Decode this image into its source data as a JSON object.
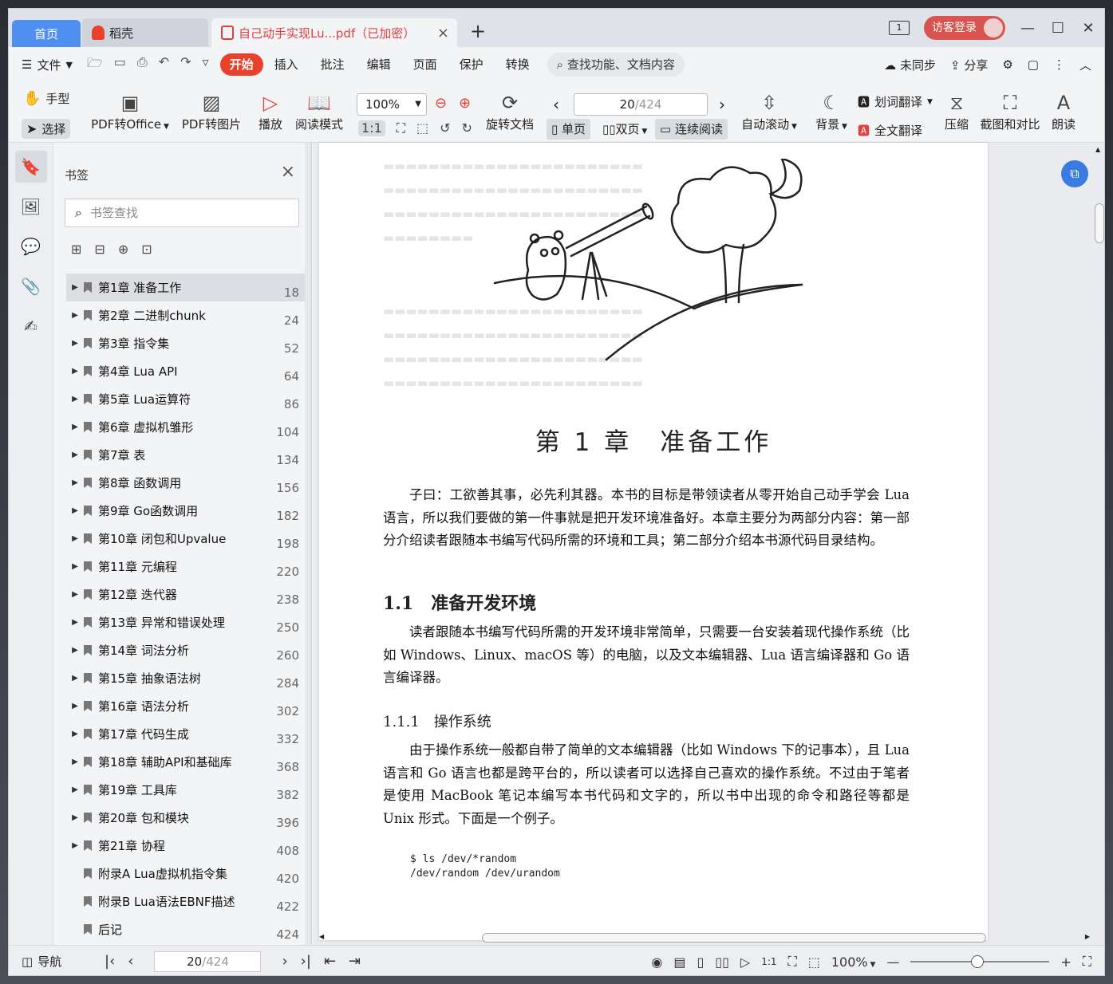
{
  "tabs": {
    "home": "首页",
    "daoke": "稻壳",
    "doc": "自己动手实现Lu...pdf（已加密）",
    "close": "×",
    "new": "+"
  },
  "window": {
    "page_indicator": "1",
    "login": "访客登录",
    "minimize": "—",
    "maximize": "☐",
    "close": "✕"
  },
  "menu": {
    "file": "文件",
    "items": [
      "开始",
      "插入",
      "批注",
      "编辑",
      "页面",
      "保护",
      "转换"
    ],
    "search": "查找功能、文档内容",
    "sync": "未同步",
    "share": "分享"
  },
  "toolbar": {
    "hand": "手型",
    "select": "选择",
    "pdf_office": "PDF转Office",
    "pdf_image": "PDF转图片",
    "play": "播放",
    "read_mode": "阅读模式",
    "zoom": "100%",
    "rotate": "旋转文档",
    "page_current": "20",
    "page_total": "/424",
    "single": "单页",
    "double": "双页",
    "continuous": "连续阅读",
    "auto_scroll": "自动滚动",
    "background": "背景",
    "word_translate": "划词翻译",
    "full_translate": "全文翻译",
    "compress": "压缩",
    "screenshot": "截图和对比",
    "read_aloud": "朗读"
  },
  "panel": {
    "title": "书签",
    "search_placeholder": "书签查找",
    "bookmarks": [
      {
        "label": "第1章 准备工作",
        "page": "18",
        "expand": true
      },
      {
        "label": "第2章 二进制chunk",
        "page": "24",
        "expand": true
      },
      {
        "label": "第3章 指令集",
        "page": "52",
        "expand": true
      },
      {
        "label": "第4章 Lua API",
        "page": "64",
        "expand": true
      },
      {
        "label": "第5章 Lua运算符",
        "page": "86",
        "expand": true
      },
      {
        "label": "第6章 虚拟机雏形",
        "page": "104",
        "expand": true
      },
      {
        "label": "第7章 表",
        "page": "134",
        "expand": true
      },
      {
        "label": "第8章 函数调用",
        "page": "156",
        "expand": true
      },
      {
        "label": "第9章 Go函数调用",
        "page": "182",
        "expand": true
      },
      {
        "label": "第10章 闭包和Upvalue",
        "page": "198",
        "expand": true
      },
      {
        "label": "第11章 元编程",
        "page": "220",
        "expand": true
      },
      {
        "label": "第12章 迭代器",
        "page": "238",
        "expand": true
      },
      {
        "label": "第13章 异常和错误处理",
        "page": "250",
        "expand": true
      },
      {
        "label": "第14章 词法分析",
        "page": "260",
        "expand": true
      },
      {
        "label": "第15章 抽象语法树",
        "page": "284",
        "expand": true
      },
      {
        "label": "第16章 语法分析",
        "page": "302",
        "expand": true
      },
      {
        "label": "第17章 代码生成",
        "page": "332",
        "expand": true
      },
      {
        "label": "第18章 辅助API和基础库",
        "page": "368",
        "expand": true
      },
      {
        "label": "第19章 工具库",
        "page": "382",
        "expand": true
      },
      {
        "label": "第20章 包和模块",
        "page": "396",
        "expand": true
      },
      {
        "label": "第21章 协程",
        "page": "408",
        "expand": true
      },
      {
        "label": "附录A Lua虚拟机指令集",
        "page": "420",
        "expand": false
      },
      {
        "label": "附录B Lua语法EBNF描述",
        "page": "422",
        "expand": false
      },
      {
        "label": "后记",
        "page": "424",
        "expand": false
      }
    ]
  },
  "document": {
    "chapter_title": "第 1 章　准备工作",
    "intro": "子曰：工欲善其事，必先利其器。本书的目标是带领读者从零开始自己动手学会 Lua 语言，所以我们要做的第一件事就是把开发环境准备好。本章主要分为两部分内容：第一部分介绍读者跟随本书编写代码所需的环境和工具；第二部分介绍本书源代码目录结构。",
    "section_title": "1.1　准备开发环境",
    "section_para": "读者跟随本书编写代码所需的开发环境非常简单，只需要一台安装着现代操作系统（比如 Windows、Linux、macOS 等）的电脑，以及文本编辑器、Lua 语言编译器和 Go 语言编译器。",
    "subsection_title": "1.1.1　操作系统",
    "subsection_para": "由于操作系统一般都自带了简单的文本编辑器（比如 Windows 下的记事本），且 Lua 语言和 Go 语言也都是跨平台的，所以读者可以选择自己喜欢的操作系统。不过由于笔者是使用 MacBook 笔记本编写本书代码和文字的，所以书中出现的命令和路径等都是 Unix 形式。下面是一个例子。",
    "code_line1": "$ ls /dev/*random",
    "code_line2": "/dev/random /dev/urandom"
  },
  "status": {
    "nav": "导航",
    "page_current": "20",
    "page_total": "/424",
    "zoom": "100%"
  }
}
